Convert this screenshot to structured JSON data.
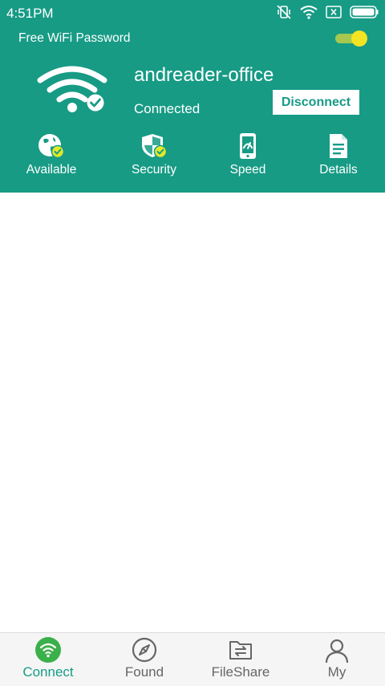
{
  "status_bar": {
    "time": "4:51PM",
    "icons": [
      "vibrate-off-icon",
      "wifi-icon",
      "sim-x-icon",
      "battery-icon"
    ]
  },
  "header": {
    "title": "Free WiFi Password",
    "toggle_on": true,
    "ssid": "andreader-office",
    "status": "Connected",
    "disconnect_label": "Disconnect"
  },
  "quick_actions": [
    {
      "label": "Available",
      "icon": "globe-check-icon"
    },
    {
      "label": "Security",
      "icon": "shield-check-icon"
    },
    {
      "label": "Speed",
      "icon": "speedometer-phone-icon"
    },
    {
      "label": "Details",
      "icon": "document-icon"
    }
  ],
  "bottom_nav": [
    {
      "label": "Connect",
      "icon": "wifi-circle-icon",
      "active": true
    },
    {
      "label": "Found",
      "icon": "compass-icon",
      "active": false
    },
    {
      "label": "FileShare",
      "icon": "file-transfer-icon",
      "active": false
    },
    {
      "label": "My",
      "icon": "person-icon",
      "active": false
    }
  ],
  "colors": {
    "primary": "#179b85",
    "toggle_knob": "#f2e422",
    "toggle_track": "#a6c84e",
    "badge_yellow": "#e2e82a",
    "nav_inactive": "#666666"
  }
}
